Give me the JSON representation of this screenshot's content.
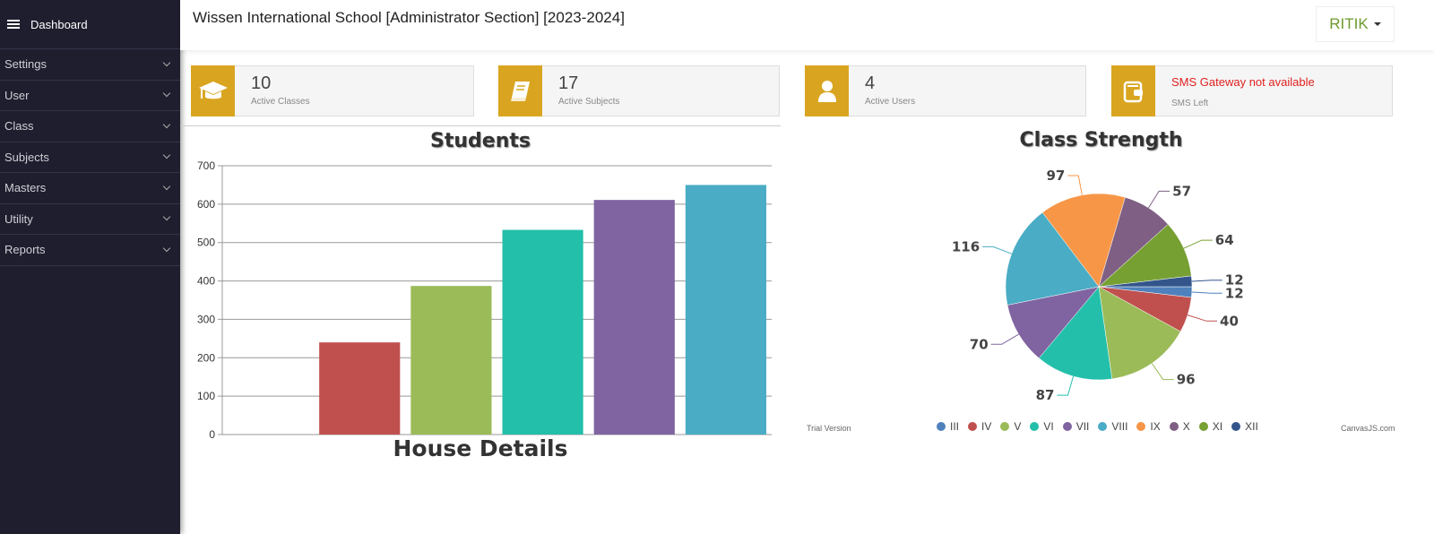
{
  "sidebar": {
    "header": "Dashboard",
    "items": [
      {
        "label": "Settings"
      },
      {
        "label": "User"
      },
      {
        "label": "Class"
      },
      {
        "label": "Subjects"
      },
      {
        "label": "Masters"
      },
      {
        "label": "Utility"
      },
      {
        "label": "Reports"
      }
    ]
  },
  "header": {
    "title": "Wissen International School [Administrator Section] [2023-2024]",
    "user": "RITIK"
  },
  "cards": [
    {
      "value": "10",
      "label": "Active Classes",
      "icon": "graduation-cap-icon"
    },
    {
      "value": "17",
      "label": "Active Subjects",
      "icon": "book-icon"
    },
    {
      "value": "4",
      "label": "Active Users",
      "icon": "user-icon"
    },
    {
      "value": "SMS Gateway not available",
      "label": "SMS Left",
      "icon": "wallet-icon"
    }
  ],
  "colors": {
    "accent": "#d9a521",
    "sidebar": "#1f1e2e",
    "user": "#6c9a2c",
    "error": "#e02020"
  },
  "house_title": "House Details",
  "watermarks": {
    "trial": "Trial Version",
    "brand": "CanvasJS.com"
  },
  "chart_data": [
    {
      "type": "bar",
      "title": "Students",
      "ylim": [
        0,
        700
      ],
      "yticks": [
        0,
        100,
        200,
        300,
        400,
        500,
        600,
        700
      ],
      "grid": true,
      "values": [
        0,
        240,
        387,
        533,
        611,
        650
      ],
      "colors": [
        "#4f81bc",
        "#c0504e",
        "#9bbb58",
        "#23bfaa",
        "#8064a1",
        "#4aacc5"
      ]
    },
    {
      "type": "pie",
      "title": "Class Strength",
      "legend": "bottom",
      "categories": [
        "III",
        "IV",
        "V",
        "VI",
        "VII",
        "VIII",
        "IX",
        "X",
        "XI",
        "XII"
      ],
      "values": [
        12,
        40,
        96,
        87,
        70,
        116,
        97,
        57,
        64,
        12
      ],
      "colors": [
        "#4f81bc",
        "#c0504e",
        "#9bbb58",
        "#23bfaa",
        "#8064a1",
        "#4aacc5",
        "#f79647",
        "#7f6084",
        "#77a033",
        "#33558b"
      ]
    }
  ]
}
